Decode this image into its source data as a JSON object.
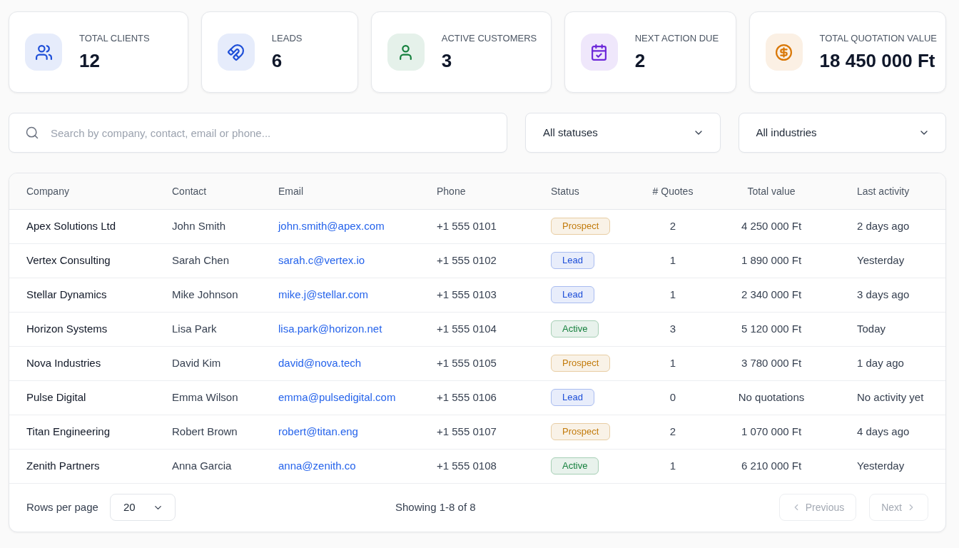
{
  "stats": [
    {
      "kind": "clients",
      "label": "TOTAL CLIENTS",
      "value": "12",
      "color": "#1d4ed8"
    },
    {
      "kind": "leads",
      "label": "LEADS",
      "value": "6",
      "color": "#1d4ed8"
    },
    {
      "kind": "customers",
      "label": "ACTIVE CUSTOMERS",
      "value": "3",
      "color": "#15803d"
    },
    {
      "kind": "due",
      "label": "NEXT ACTION DUE",
      "value": "2",
      "color": "#6d28d9"
    },
    {
      "kind": "money",
      "label": "TOTAL QUOTATION VALUE",
      "value": "18 450 000 Ft",
      "color": "#d97706"
    }
  ],
  "filters": {
    "search": {
      "placeholder": "Search by company, contact, email or phone..."
    },
    "status": {
      "value": "All statuses"
    },
    "industry": {
      "value": "All industries"
    }
  },
  "table": {
    "columns": [
      "Company",
      "Contact",
      "Email",
      "Phone",
      "Status",
      "# Quotes",
      "Total value",
      "Last activity"
    ],
    "rows": [
      {
        "company": "Apex Solutions Ltd",
        "contact": "John Smith",
        "email": "john.smith@apex.com",
        "phone": "+1 555 0101",
        "status": {
          "label": "Prospect",
          "color": "#c27b0c"
        },
        "quotes": "2",
        "total_value": "4 250 000 Ft",
        "last_activity": "2 days ago"
      },
      {
        "company": "Vertex Consulting",
        "contact": "Sarah Chen",
        "email": "sarah.c@vertex.io",
        "phone": "+1 555 0102",
        "status": {
          "label": "Lead",
          "color": "#1d4ed8"
        },
        "quotes": "1",
        "total_value": "1 890 000 Ft",
        "last_activity": "Yesterday"
      },
      {
        "company": "Stellar Dynamics",
        "contact": "Mike Johnson",
        "email": "mike.j@stellar.com",
        "phone": "+1 555 0103",
        "status": {
          "label": "Lead",
          "color": "#1d4ed8"
        },
        "quotes": "1",
        "total_value": "2 340 000 Ft",
        "last_activity": "3 days ago"
      },
      {
        "company": "Horizon Systems",
        "contact": "Lisa Park",
        "email": "lisa.park@horizon.net",
        "phone": "+1 555 0104",
        "status": {
          "label": "Active",
          "color": "#15803d"
        },
        "quotes": "3",
        "total_value": "5 120 000 Ft",
        "last_activity": "Today"
      },
      {
        "company": "Nova Industries",
        "contact": "David Kim",
        "email": "david@nova.tech",
        "phone": "+1 555 0105",
        "status": {
          "label": "Prospect",
          "color": "#c27b0c"
        },
        "quotes": "1",
        "total_value": "3 780 000 Ft",
        "last_activity": "1 day ago"
      },
      {
        "company": "Pulse Digital",
        "contact": "Emma Wilson",
        "email": "emma@pulsedigital.com",
        "phone": "+1 555 0106",
        "status": {
          "label": "Lead",
          "color": "#1d4ed8"
        },
        "quotes": "0",
        "total_value": "No quotations",
        "last_activity": "No activity yet"
      },
      {
        "company": "Titan Engineering",
        "contact": "Robert Brown",
        "email": "robert@titan.eng",
        "phone": "+1 555 0107",
        "status": {
          "label": "Prospect",
          "color": "#c27b0c"
        },
        "quotes": "2",
        "total_value": "1 070 000 Ft",
        "last_activity": "4 days ago"
      },
      {
        "company": "Zenith Partners",
        "contact": "Anna Garcia",
        "email": "anna@zenith.co",
        "phone": "+1 555 0108",
        "status": {
          "label": "Active",
          "color": "#15803d"
        },
        "quotes": "1",
        "total_value": "6 210 000 Ft",
        "last_activity": "Yesterday"
      }
    ]
  },
  "pagination": {
    "rows_per_page_label": "Rows per page",
    "rows_per_page": "20",
    "summary": "Showing 1-8 of 8",
    "buttons": [
      {
        "kind": "previous",
        "label": "Previous",
        "disabled": true
      },
      {
        "kind": "next",
        "label": "Next",
        "disabled": true
      }
    ]
  }
}
